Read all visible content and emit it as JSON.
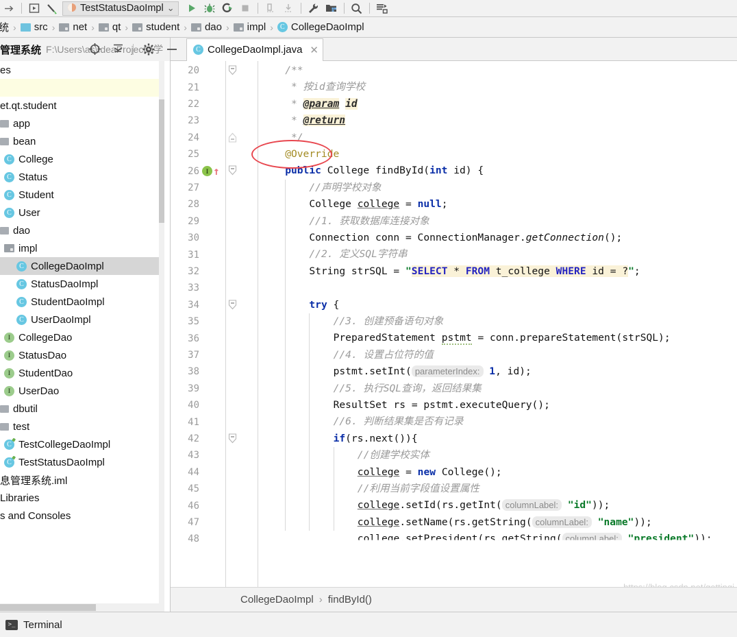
{
  "toolbar": {
    "icons": [
      {
        "name": "forward-arrow-icon",
        "glyph": "→"
      },
      {
        "name": "run-config-dropdown-icon",
        "glyph": "▶"
      },
      {
        "name": "build-hammer-icon",
        "glyph": "⚒"
      }
    ],
    "run_configuration": "TestStatusDaoImpl",
    "run_config_caret": "⌄",
    "buttons": [
      {
        "name": "run-button",
        "title": "Run"
      },
      {
        "name": "debug-button",
        "title": "Debug"
      },
      {
        "name": "run-with-coverage-button",
        "title": "Run with Coverage"
      },
      {
        "name": "stop-button",
        "title": "Stop"
      },
      {
        "name": "update-application-button",
        "title": "Update"
      },
      {
        "name": "pull-button",
        "title": "Pull"
      },
      {
        "name": "settings-wrench-button",
        "title": "Settings"
      },
      {
        "name": "project-structure-button",
        "title": "Project Structure"
      },
      {
        "name": "search-everywhere-button",
        "title": "Search Everywhere"
      },
      {
        "name": "database-button",
        "title": "Database"
      }
    ]
  },
  "breadcrumb": {
    "items": [
      {
        "label": "统",
        "icon": "truncated-project-icon"
      },
      {
        "label": "src",
        "icon": "source-folder-icon"
      },
      {
        "label": "net",
        "icon": "folder-icon"
      },
      {
        "label": "qt",
        "icon": "folder-icon"
      },
      {
        "label": "student",
        "icon": "folder-icon"
      },
      {
        "label": "dao",
        "icon": "folder-icon"
      },
      {
        "label": "impl",
        "icon": "folder-icon"
      },
      {
        "label": "CollegeDaoImpl",
        "icon": "class-icon"
      }
    ],
    "separator": "›"
  },
  "project_panel": {
    "title": "管理系统",
    "path": "F:\\Users\\as\\IdeaProjects\\学",
    "toolbar_icons": [
      {
        "name": "locate-target-icon",
        "glyph": "⊕"
      },
      {
        "name": "collapse-all-icon",
        "glyph": "⤓"
      },
      {
        "name": "settings-gear-icon",
        "glyph": "⚙"
      },
      {
        "name": "hide-panel-icon",
        "glyph": "—"
      }
    ],
    "tree": [
      {
        "label": "es",
        "type": "truncated",
        "indent": 0,
        "state": "normal"
      },
      {
        "label": "",
        "type": "blank-modified",
        "indent": 0,
        "state": "modified"
      },
      {
        "label": "et.qt.student",
        "type": "truncated-package",
        "indent": 0,
        "state": "normal"
      },
      {
        "label": "app",
        "type": "package",
        "indent": 0,
        "state": "normal"
      },
      {
        "label": "bean",
        "type": "package",
        "indent": 0,
        "state": "normal"
      },
      {
        "label": "College",
        "type": "class",
        "indent": 1,
        "state": "normal"
      },
      {
        "label": "Status",
        "type": "class",
        "indent": 1,
        "state": "normal"
      },
      {
        "label": "Student",
        "type": "class",
        "indent": 1,
        "state": "normal"
      },
      {
        "label": "User",
        "type": "class",
        "indent": 1,
        "state": "normal"
      },
      {
        "label": "dao",
        "type": "package",
        "indent": 0,
        "state": "normal"
      },
      {
        "label": "impl",
        "type": "folder",
        "indent": 1,
        "state": "normal"
      },
      {
        "label": "CollegeDaoImpl",
        "type": "class",
        "indent": 2,
        "state": "selected"
      },
      {
        "label": "StatusDaoImpl",
        "type": "class",
        "indent": 2,
        "state": "normal"
      },
      {
        "label": "StudentDaoImpl",
        "type": "class",
        "indent": 2,
        "state": "normal"
      },
      {
        "label": "UserDaoImpl",
        "type": "class",
        "indent": 2,
        "state": "normal"
      },
      {
        "label": "CollegeDao",
        "type": "interface",
        "indent": 1,
        "state": "normal"
      },
      {
        "label": "StatusDao",
        "type": "interface",
        "indent": 1,
        "state": "normal"
      },
      {
        "label": "StudentDao",
        "type": "interface",
        "indent": 1,
        "state": "normal"
      },
      {
        "label": "UserDao",
        "type": "interface",
        "indent": 1,
        "state": "normal"
      },
      {
        "label": "dbutil",
        "type": "package",
        "indent": 0,
        "state": "normal"
      },
      {
        "label": "test",
        "type": "package",
        "indent": 0,
        "state": "normal"
      },
      {
        "label": "TestCollegeDaoImpl",
        "type": "test-class",
        "indent": 1,
        "state": "normal"
      },
      {
        "label": "TestStatusDaoImpl",
        "type": "test-class",
        "indent": 1,
        "state": "normal"
      },
      {
        "label": "息管理系统.iml",
        "type": "truncated",
        "indent": 0,
        "state": "normal"
      },
      {
        "label": "Libraries",
        "type": "truncated",
        "indent": 0,
        "state": "normal"
      },
      {
        "label": "s and Consoles",
        "type": "truncated",
        "indent": 0,
        "state": "normal"
      }
    ]
  },
  "editor": {
    "toolbar_icons": [
      {
        "name": "locate-target-icon",
        "glyph": "⊕"
      },
      {
        "name": "collapse-all-icon",
        "glyph": "⤓"
      },
      {
        "name": "settings-gear-icon",
        "glyph": "⚙"
      },
      {
        "name": "hide-panel-icon",
        "glyph": "—"
      }
    ],
    "tab": {
      "filename": "CollegeDaoImpl.java",
      "icon": "java-class-icon",
      "close_glyph": "✕"
    },
    "first_line_number": 20,
    "last_line_number": 48,
    "breadcrumb_bottom": [
      "CollegeDaoImpl",
      "findById()"
    ],
    "breadcrumb_bottom_sep": "›",
    "watermark": "https://blog.csdn.net/gettingi",
    "gutter_icons": [
      {
        "line": 26,
        "name": "implementing-method-icon",
        "glyph": "I"
      },
      {
        "line": 26,
        "name": "overriding-method-arrow-icon",
        "glyph": "↑"
      }
    ],
    "annotation": {
      "name": "red-ellipse-highlight",
      "target": "@Override"
    },
    "lines": [
      {
        "n": 20,
        "indent": 1,
        "fold": "start",
        "tokens": [
          {
            "t": "/**",
            "c": "cmt"
          }
        ]
      },
      {
        "n": 21,
        "indent": 1,
        "tokens": [
          {
            "t": " * 按id查询学校",
            "c": "cmt"
          }
        ]
      },
      {
        "n": 22,
        "indent": 1,
        "tokens": [
          {
            "t": " * ",
            "c": "cmt"
          },
          {
            "t": "@param",
            "c": "jdtag"
          },
          {
            "t": " ",
            "c": "cmt"
          },
          {
            "t": "id",
            "c": "jdval"
          }
        ]
      },
      {
        "n": 23,
        "indent": 1,
        "tokens": [
          {
            "t": " * ",
            "c": "cmt"
          },
          {
            "t": "@return",
            "c": "jdtag"
          }
        ]
      },
      {
        "n": 24,
        "indent": 1,
        "fold": "end",
        "tokens": [
          {
            "t": " */",
            "c": "cmt"
          }
        ]
      },
      {
        "n": 25,
        "indent": 1,
        "tokens": [
          {
            "t": "@Override",
            "c": "anno"
          }
        ]
      },
      {
        "n": 26,
        "indent": 1,
        "fold": "start",
        "tokens": [
          {
            "t": "public",
            "c": "kw"
          },
          {
            "t": " College findById(",
            "c": ""
          },
          {
            "t": "int",
            "c": "kw"
          },
          {
            "t": " id) {",
            "c": ""
          }
        ]
      },
      {
        "n": 27,
        "indent": 2,
        "tokens": [
          {
            "t": "//声明学校对象",
            "c": "cmt"
          }
        ]
      },
      {
        "n": 28,
        "indent": 2,
        "tokens": [
          {
            "t": "College ",
            "c": ""
          },
          {
            "t": "college",
            "c": "field"
          },
          {
            "t": " = ",
            "c": ""
          },
          {
            "t": "null",
            "c": "kw"
          },
          {
            "t": ";",
            "c": ""
          }
        ]
      },
      {
        "n": 29,
        "indent": 2,
        "tokens": [
          {
            "t": "//1. 获取数据库连接对象",
            "c": "cmt"
          }
        ]
      },
      {
        "n": 30,
        "indent": 2,
        "tokens": [
          {
            "t": "Connection conn = ConnectionManager.",
            "c": ""
          },
          {
            "t": "getConnection",
            "c": "mstatic"
          },
          {
            "t": "();",
            "c": ""
          }
        ]
      },
      {
        "n": 31,
        "indent": 2,
        "tokens": [
          {
            "t": "//2. 定义SQL字符串",
            "c": "cmt"
          }
        ]
      },
      {
        "n": 32,
        "indent": 2,
        "tokens": [
          {
            "t": "String strSQL = ",
            "c": ""
          },
          {
            "t": "\"",
            "c": "str"
          },
          {
            "t": "SELECT",
            "c": "sqlkw-hl"
          },
          {
            "t": " * ",
            "c": "hl"
          },
          {
            "t": "FROM",
            "c": "sqlkw-hl"
          },
          {
            "t": " t_college ",
            "c": "hl"
          },
          {
            "t": "WHERE",
            "c": "sqlkw-hl"
          },
          {
            "t": " id = ?",
            "c": "hl"
          },
          {
            "t": "\"",
            "c": "str"
          },
          {
            "t": ";",
            "c": ""
          }
        ]
      },
      {
        "n": 33,
        "indent": 2,
        "tokens": []
      },
      {
        "n": 34,
        "indent": 2,
        "fold": "start",
        "tokens": [
          {
            "t": "try",
            "c": "kw"
          },
          {
            "t": " {",
            "c": ""
          }
        ]
      },
      {
        "n": 35,
        "indent": 3,
        "tokens": [
          {
            "t": "//3. 创建预备语句对象",
            "c": "cmt"
          }
        ]
      },
      {
        "n": 36,
        "indent": 3,
        "tokens": [
          {
            "t": "PreparedStatement ",
            "c": ""
          },
          {
            "t": "pstmt",
            "c": "typo"
          },
          {
            "t": " = conn.prepareStatement(strSQL);",
            "c": ""
          }
        ]
      },
      {
        "n": 37,
        "indent": 3,
        "tokens": [
          {
            "t": "//4. 设置占位符的值",
            "c": "cmt"
          }
        ]
      },
      {
        "n": 38,
        "indent": 3,
        "tokens": [
          {
            "t": "pstmt.setInt(",
            "c": ""
          },
          {
            "t": "parameterIndex:",
            "c": "hint"
          },
          {
            "t": " ",
            "c": ""
          },
          {
            "t": "1",
            "c": "kw"
          },
          {
            "t": ", id);",
            "c": ""
          }
        ]
      },
      {
        "n": 39,
        "indent": 3,
        "tokens": [
          {
            "t": "//5. 执行SQL查询，返回结果集",
            "c": "cmt"
          }
        ]
      },
      {
        "n": 40,
        "indent": 3,
        "tokens": [
          {
            "t": "ResultSet rs = pstmt.executeQuery();",
            "c": ""
          }
        ]
      },
      {
        "n": 41,
        "indent": 3,
        "tokens": [
          {
            "t": "//6. 判断结果集是否有记录",
            "c": "cmt"
          }
        ]
      },
      {
        "n": 42,
        "indent": 3,
        "fold": "start",
        "tokens": [
          {
            "t": "if",
            "c": "kw"
          },
          {
            "t": "(rs.next()){",
            "c": ""
          }
        ]
      },
      {
        "n": 43,
        "indent": 4,
        "tokens": [
          {
            "t": "//创建学校实体",
            "c": "cmt"
          }
        ]
      },
      {
        "n": 44,
        "indent": 4,
        "tokens": [
          {
            "t": "college",
            "c": "field"
          },
          {
            "t": " = ",
            "c": ""
          },
          {
            "t": "new",
            "c": "kw"
          },
          {
            "t": " College();",
            "c": ""
          }
        ]
      },
      {
        "n": 45,
        "indent": 4,
        "tokens": [
          {
            "t": "//利用当前字段值设置属性",
            "c": "cmt"
          }
        ]
      },
      {
        "n": 46,
        "indent": 4,
        "tokens": [
          {
            "t": "college",
            "c": "field"
          },
          {
            "t": ".setId(rs.getInt(",
            "c": ""
          },
          {
            "t": "columnLabel:",
            "c": "hint"
          },
          {
            "t": " ",
            "c": ""
          },
          {
            "t": "\"id\"",
            "c": "str"
          },
          {
            "t": "));",
            "c": ""
          }
        ]
      },
      {
        "n": 47,
        "indent": 4,
        "tokens": [
          {
            "t": "college",
            "c": "field"
          },
          {
            "t": ".setName(rs.getString(",
            "c": ""
          },
          {
            "t": "columnLabel:",
            "c": "hint"
          },
          {
            "t": " ",
            "c": ""
          },
          {
            "t": "\"name\"",
            "c": "str"
          },
          {
            "t": "));",
            "c": ""
          }
        ]
      },
      {
        "n": 48,
        "indent": 4,
        "clipped": true,
        "tokens": [
          {
            "t": "college",
            "c": "field"
          },
          {
            "t": ".setPresident(rs.getString(",
            "c": ""
          },
          {
            "t": "columnLabel:",
            "c": "hint"
          },
          {
            "t": " ",
            "c": ""
          },
          {
            "t": "\"president\"",
            "c": "str"
          },
          {
            "t": "));",
            "c": ""
          }
        ]
      }
    ]
  },
  "statusbar": {
    "terminal_label": "Terminal",
    "terminal_icon": "terminal-icon"
  },
  "colors": {
    "accent_blue": "#67c7e2",
    "interface_green": "#9ccc8c",
    "annotation_yellow": "#a38b23",
    "keyword_blue": "#0b2fa8",
    "string_green": "#0a7a29",
    "comment_gray": "#9a9a9a",
    "highlight_red": "#e8474f",
    "sql_highlight_bg": "#faf2d8"
  }
}
